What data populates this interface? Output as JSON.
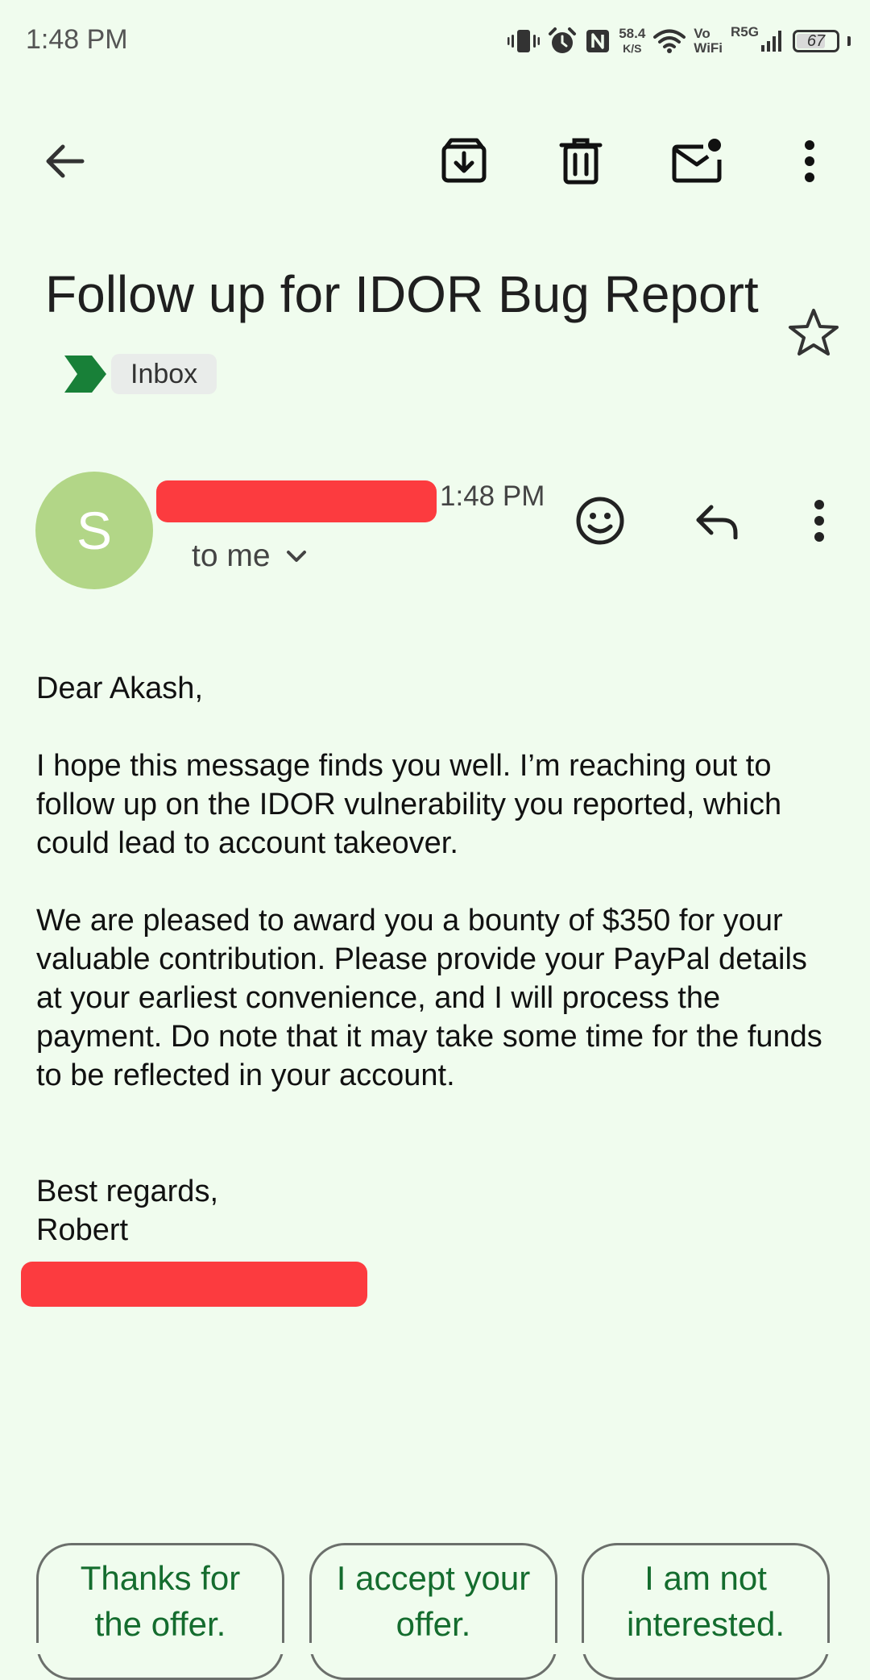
{
  "status_bar": {
    "time": "1:48 PM",
    "net_speed_value": "58.4",
    "net_speed_unit": "K/S",
    "vowifi_top": "Vo",
    "vowifi_bottom": "WiFi",
    "network_label": "R5G",
    "battery_level": "67",
    "icons": [
      "vibrate-icon",
      "alarm-icon",
      "nfc-icon",
      "wifi-icon",
      "signal-icon",
      "battery-icon"
    ]
  },
  "toolbar": {
    "icons": [
      "back-arrow-icon",
      "archive-icon",
      "delete-icon",
      "mark-unread-icon",
      "more-vert-icon"
    ]
  },
  "email": {
    "subject": "Follow up for IDOR Bug Report",
    "label": "Inbox",
    "label_color": "#188038",
    "avatar_letter": "S",
    "avatar_color": "#b2d687",
    "time": "1:48 PM",
    "recipient": "to me",
    "body": {
      "greeting": "Dear Akash,",
      "paragraph1": "I hope this message finds you well. I’m reaching out to follow up on the IDOR vulnerability you reported, which could lead to account takeover.",
      "paragraph2": "We are pleased to award you a bounty of $350 for your valuable contribution. Please provide your PayPal details at your earliest convenience, and I will process the payment. Do note that it may take some time for the funds to be reflected in your account.",
      "signoff": "Best regards,",
      "signature": "Robert"
    },
    "redaction_color": "#fc3b3f"
  },
  "smart_replies": [
    {
      "line1": "Thanks for",
      "line2": "the offer."
    },
    {
      "line1": "I accept your",
      "line2": "offer."
    },
    {
      "line1": "I am not",
      "line2": "interested."
    }
  ],
  "colors": {
    "background": "#f0fcee",
    "reply_text": "#146c2e"
  }
}
